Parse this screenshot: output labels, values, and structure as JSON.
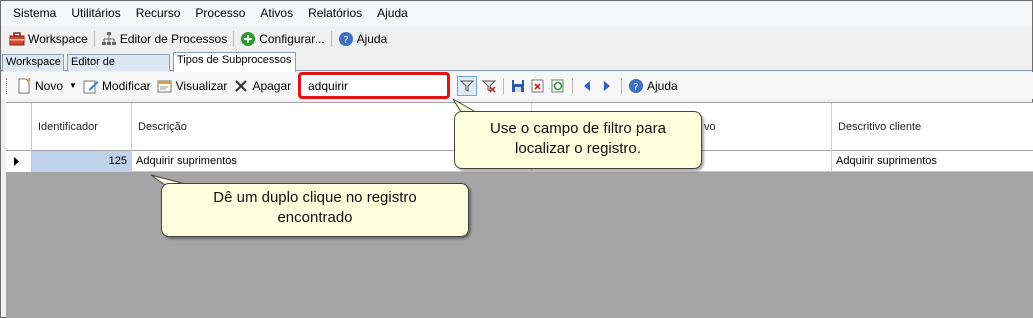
{
  "menu": [
    "Sistema",
    "Utilitários",
    "Recurso",
    "Processo",
    "Ativos",
    "Relatórios",
    "Ajuda"
  ],
  "toolbar": {
    "workspace": "Workspace",
    "editor": "Editor de Processos",
    "configurar": "Configurar...",
    "ajuda": "Ajuda"
  },
  "tabs": [
    "Workspace",
    "Editor de Processos",
    "Tipos de Subprocessos"
  ],
  "subtoolbar": {
    "novo": "Novo",
    "modificar": "Modificar",
    "visualizar": "Visualizar",
    "apagar": "Apagar",
    "filter_value": "adquirir",
    "ajuda": "Ajuda"
  },
  "grid": {
    "headers": [
      "Identificador",
      "Descrição",
      "vo",
      "Descritivo cliente"
    ],
    "rows": [
      {
        "id": "125",
        "descricao": "Adquirir suprimentos",
        "ativo_checked": "✓",
        "descritivo": "Adquirir suprimentos"
      }
    ]
  },
  "callouts": {
    "filter_tip": [
      "Use o campo de filtro para",
      "localizar o registro."
    ],
    "double_click_tip": [
      "Dê um duplo clique no registro",
      "encontrado"
    ]
  },
  "colors": {
    "highlight_border": "#e01414",
    "callout_bg": "#ffffdd",
    "grid_bg": "#a5a5a5",
    "selected_cell": "#c1d3ea"
  }
}
